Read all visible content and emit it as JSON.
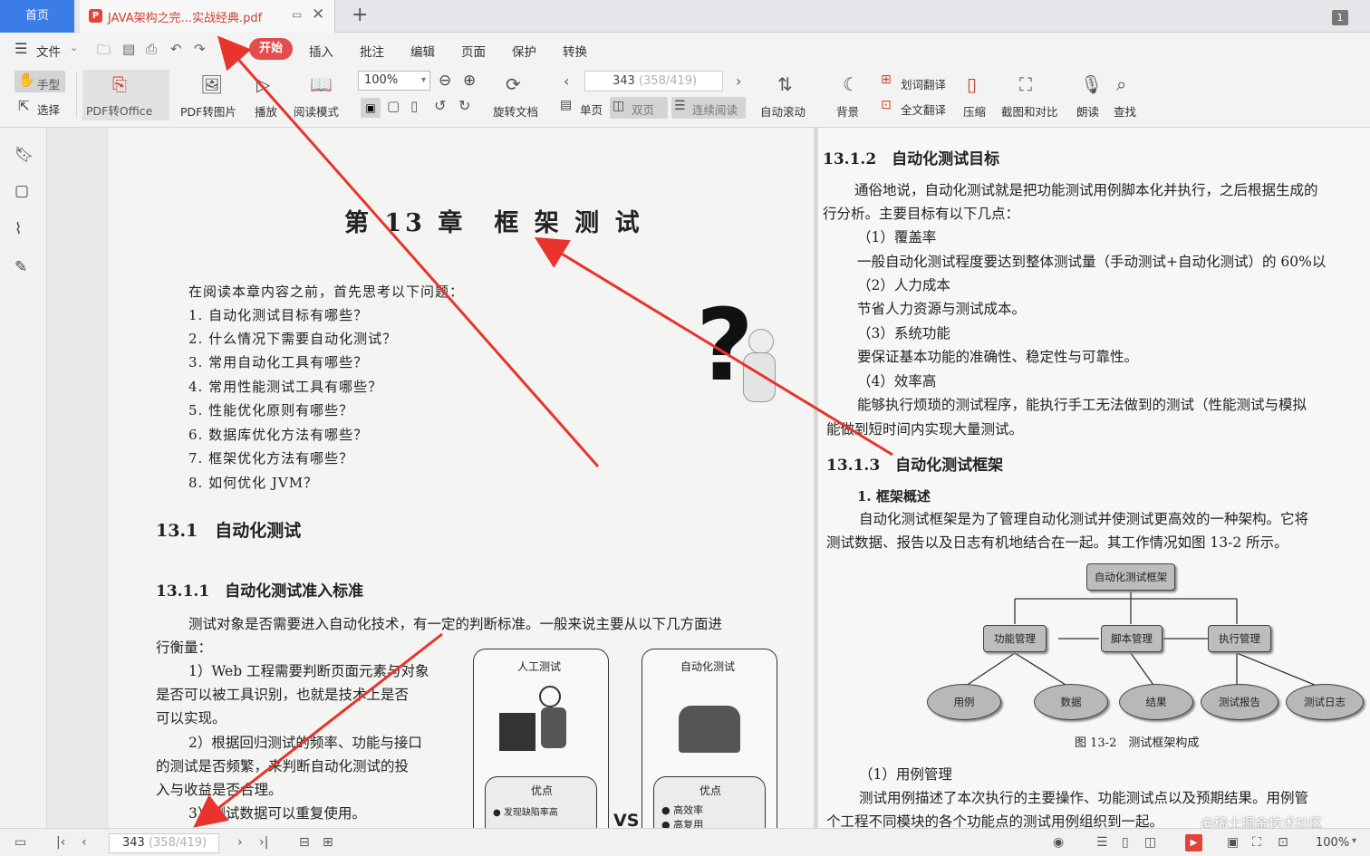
{
  "tabs": {
    "home": "首页",
    "doc_title": "JAVA架构之完...实战经典.pdf",
    "pdf_badge": "P",
    "window_count": "1"
  },
  "menu": {
    "file": "文件",
    "items": [
      "开始",
      "插入",
      "批注",
      "编辑",
      "页面",
      "保护",
      "转换"
    ]
  },
  "toolbar": {
    "hand": "手型",
    "select": "选择",
    "pdf_to_office": "PDF转Office",
    "pdf_to_image": "PDF转图片",
    "play": "播放",
    "read_mode": "阅读模式",
    "zoom": "100%",
    "rotate": "旋转文档",
    "page_current": "343",
    "page_total": "(358/419)",
    "single": "单页",
    "double": "双页",
    "continuous": "连续阅读",
    "auto_scroll": "自动滚动",
    "background": "背景",
    "word_translate": "划词翻译",
    "full_translate": "全文翻译",
    "compress": "压缩",
    "screenshot": "截图和对比",
    "read_aloud": "朗读",
    "find": "查找"
  },
  "left_page": {
    "chapter_title": "第 13 章　框 架 测 试",
    "intro": "在阅读本章内容之前，首先思考以下问题：",
    "questions": [
      "1. 自动化测试目标有哪些？",
      "2. 什么情况下需要自动化测试？",
      "3. 常用自动化工具有哪些？",
      "4. 常用性能测试工具有哪些？",
      "5. 性能优化原则有哪些？",
      "6. 数据库优化方法有哪些？",
      "7. 框架优化方法有哪些？",
      "8. 如何优化 JVM？"
    ],
    "h_13_1": "13.1　自动化测试",
    "h_13_1_1": "13.1.1　自动化测试准入标准",
    "p1a": "测试对象是否需要进入自动化技术，有一定的判断标准。一般来说主要从以下几方面进",
    "p1b": "行衡量：",
    "p2": [
      "1）Web 工程需要判断页面元素与对象",
      "是否可以被工具识别，也就是技术上是否",
      "可以实现。",
      "2）根据回归测试的频率、功能与接口",
      "的测试是否频繁，来判断自动化测试的投",
      "入与收益是否合理。",
      "3）测试数据可以重复使用。"
    ],
    "card_manual": "人工测试",
    "card_auto": "自动化测试",
    "pros": "优点",
    "pro_manual": "● 发现缺陷率高",
    "pro_auto1": "● 高效率",
    "pro_auto2": "● 高复用",
    "vs": "VS"
  },
  "right_page": {
    "h_13_1_2": "13.1.2　自动化测试目标",
    "lines": [
      "通俗地说，自动化测试就是把功能测试用例脚本化并执行，之后根据生成的",
      "行分析。主要目标有以下几点：",
      "（1）覆盖率",
      "一般自动化测试程度要达到整体测试量（手动测试+自动化测试）的 60%以",
      "（2）人力成本",
      "节省人力资源与测试成本。",
      "（3）系统功能",
      "要保证基本功能的准确性、稳定性与可靠性。",
      "（4）效率高",
      "能够执行烦琐的测试程序，能执行手工无法做到的测试（性能测试与模拟",
      "能做到短时间内实现大量测试。"
    ],
    "h_13_1_3": "13.1.3　自动化测试框架",
    "h_overview": "1. 框架概述",
    "p_overview": [
      "自动化测试框架是为了管理自动化测试并使测试更高效的一种架构。它将",
      "测试数据、报告以及日志有机地结合在一起。其工作情况如图 13-2 所示。"
    ],
    "diagram": {
      "root": "自动化测试框架",
      "mid": [
        "功能管理",
        "脚本管理",
        "执行管理"
      ],
      "leaves": [
        "用例",
        "数据",
        "结果",
        "测试报告",
        "测试日志"
      ],
      "caption": "图 13-2　测试框架构成"
    },
    "h_case": "（1）用例管理",
    "p_case": [
      "测试用例描述了本次执行的主要操作、功能测试点以及预期结果。用例管",
      "个工程不同模块的各个功能点的测试用例组织到一起。"
    ]
  },
  "watermark": "@稀土掘金技术社区",
  "status": {
    "page_current": "343",
    "page_total": "(358/419)",
    "zoom": "100%"
  },
  "colors": {
    "accent": "#3b7ce6",
    "start": "#e54c4c",
    "arrow": "#e8342c"
  }
}
